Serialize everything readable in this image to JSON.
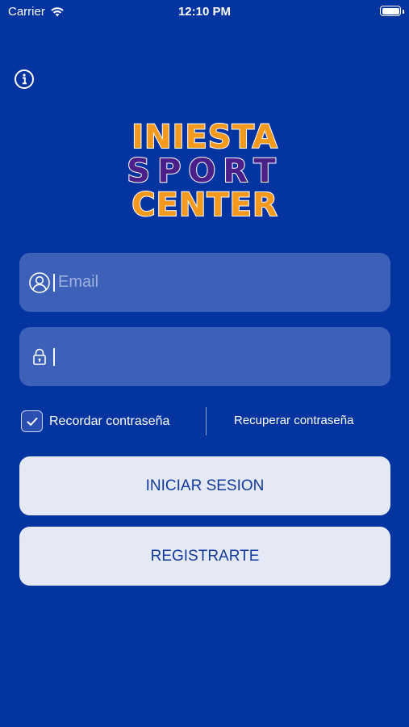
{
  "status_bar": {
    "carrier": "Carrier",
    "time": "12:10 PM"
  },
  "icons": {
    "info": "info-icon",
    "user": "user-icon",
    "lock": "lock-icon",
    "check": "checkmark-icon"
  },
  "logo": {
    "line1": "INIESTA",
    "line2": "SPORT",
    "line3": "CENTER"
  },
  "login_form": {
    "email_placeholder": "Email",
    "email_value": "",
    "password_placeholder": "",
    "password_value": "",
    "remember_label": "Recordar contraseña",
    "remember_checked": true,
    "recover_label": "Recuperar contraseña",
    "login_button": "INICIAR SESION",
    "register_button": "REGISTRARTE"
  },
  "colors": {
    "background": "#0434a0",
    "field_background": "#3d61b8",
    "button_background": "#e5e9f5",
    "button_text": "#123a9c",
    "logo_orange": "#f39a1e",
    "logo_purple": "#4a1f8a"
  }
}
